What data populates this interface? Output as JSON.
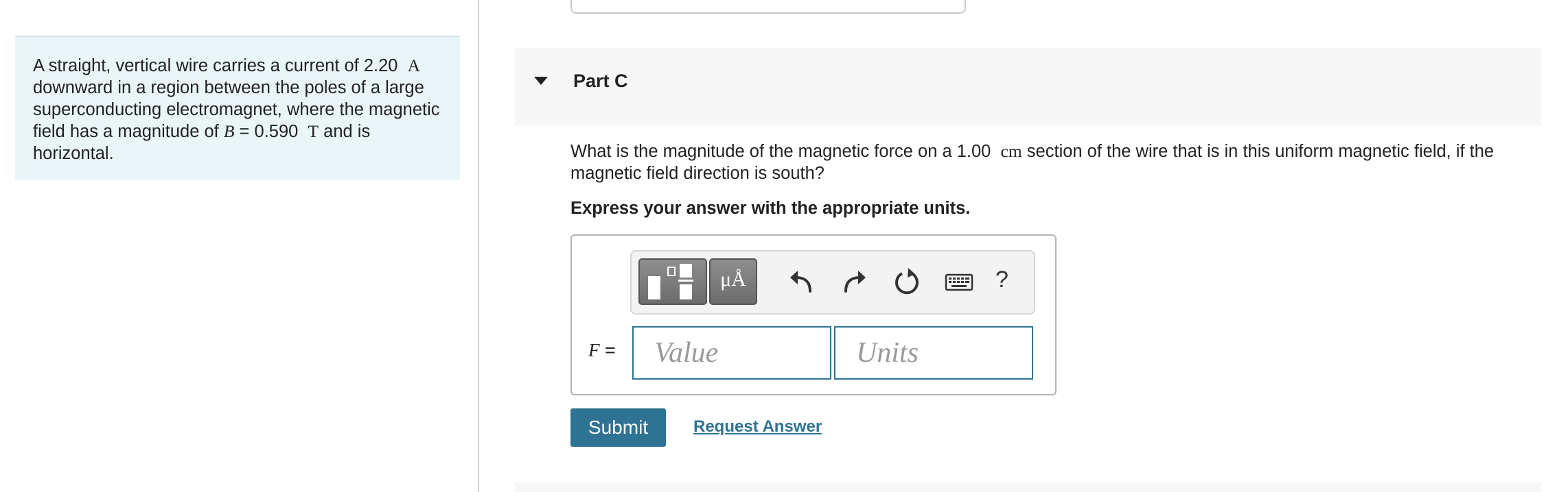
{
  "problem": {
    "text_1": "A straight, vertical wire carries a current of 2.20",
    "current_unit": "A",
    "text_2": "downward in a region between the poles of a large superconducting electromagnet, where the magnetic field has a magnitude of",
    "b_symbol": "B",
    "b_value": "= 0.590",
    "b_unit": "T",
    "text_3": "and is horizontal."
  },
  "part": {
    "title": "Part C",
    "question_1": "What is the magnitude of the magnetic force on a 1.00",
    "question_unit": "cm",
    "question_2": "section of the wire that is in this uniform magnetic field, if the magnetic field direction is south?",
    "instruction": "Express your answer with the appropriate units."
  },
  "toolbar": {
    "units_label": "μÅ",
    "help_label": "?",
    "icons": [
      "templates-icon",
      "units-icon",
      "undo-icon",
      "redo-icon",
      "reset-icon",
      "keyboard-icon",
      "help-icon"
    ]
  },
  "answer": {
    "variable": "F",
    "equals": "=",
    "value_placeholder": "Value",
    "units_placeholder": "Units"
  },
  "actions": {
    "submit_label": "Submit",
    "request_label": "Request Answer"
  },
  "colors": {
    "accent": "#2f7394",
    "problem_bg": "#e9f5f7",
    "part_header_bg": "#f7f7f7"
  }
}
